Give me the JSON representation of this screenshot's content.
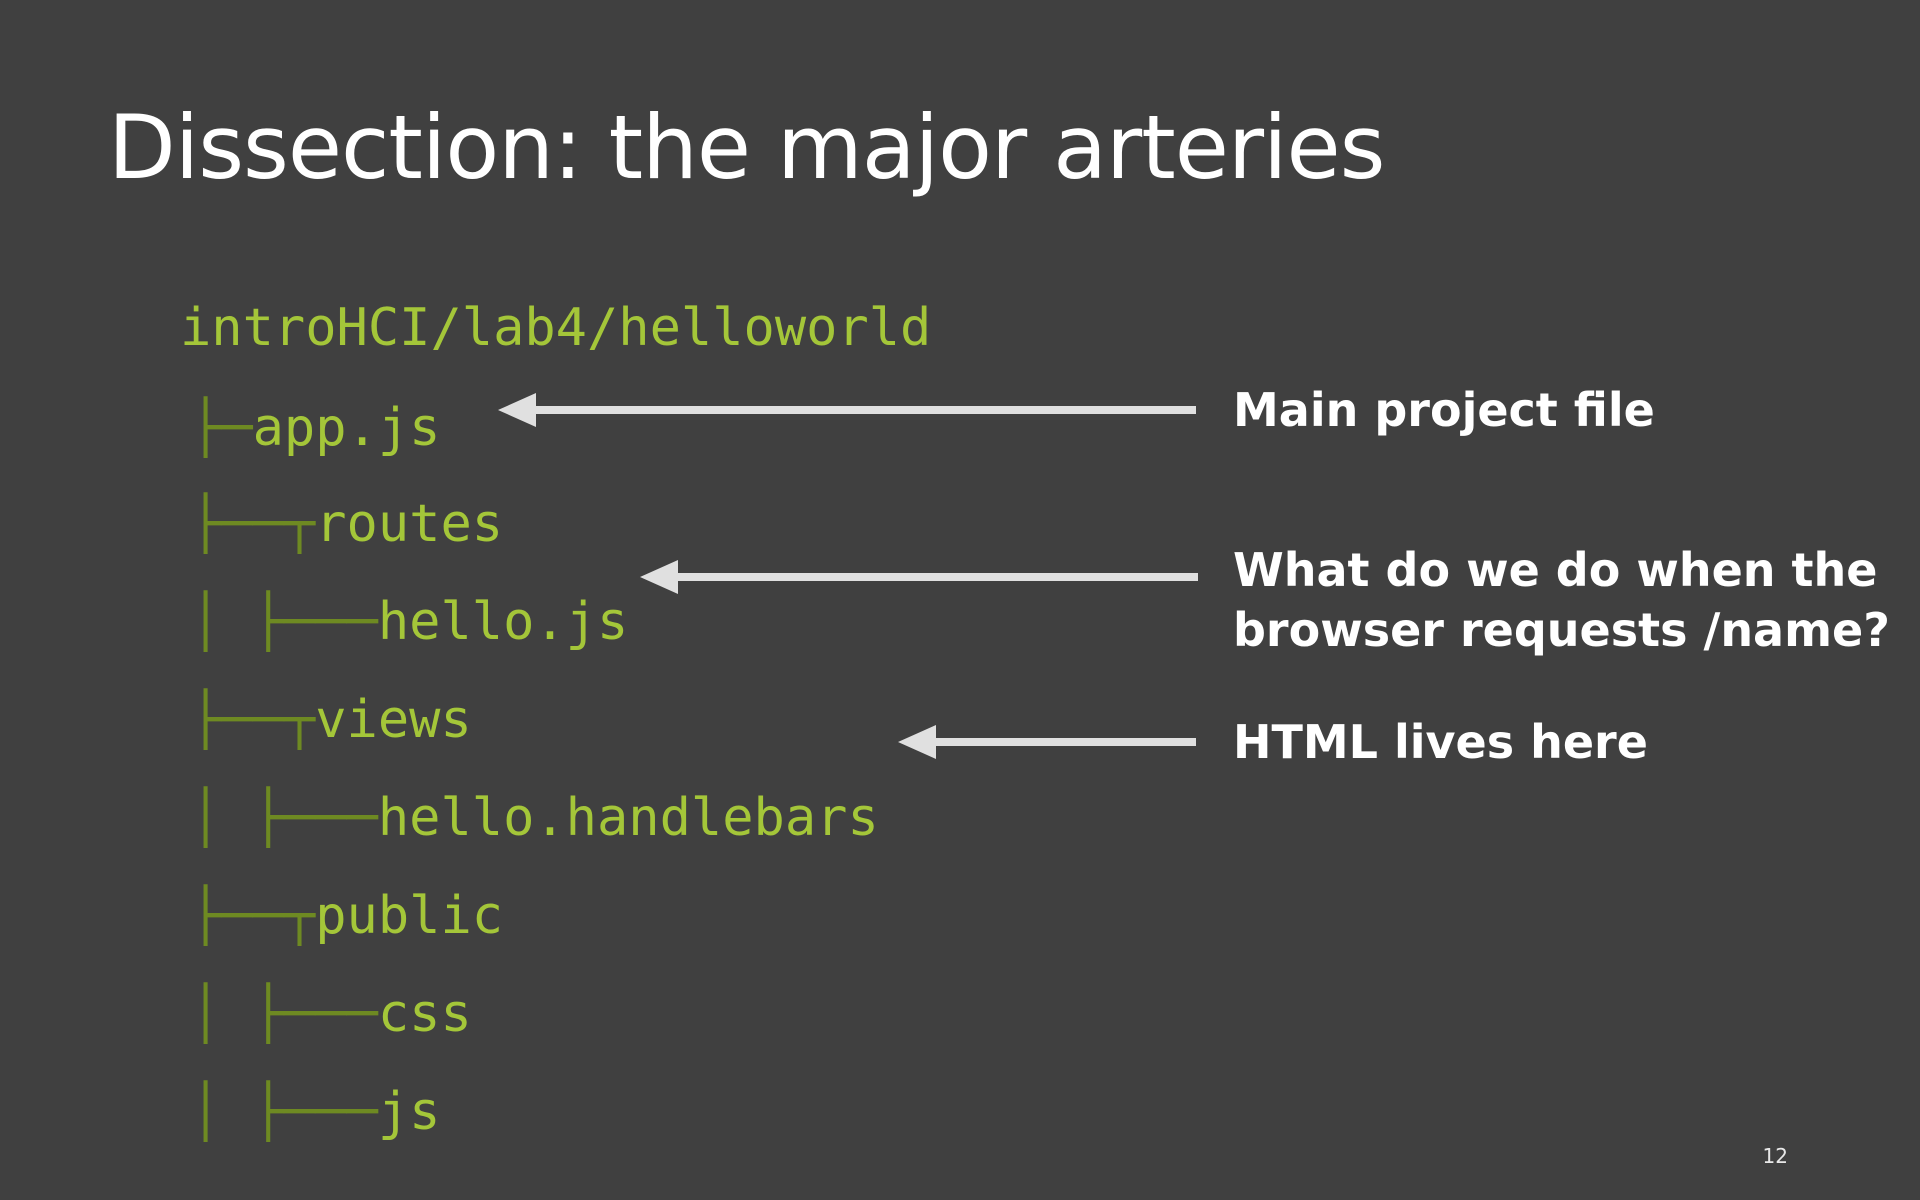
{
  "slide": {
    "title": "Dissection: the major arteries",
    "page_number": "12"
  },
  "tree": {
    "root": "introHCI/lab4/helloworld",
    "rows": [
      {
        "branch": "├─",
        "name": "app.js"
      },
      {
        "branch": "├──┬",
        "name": "routes"
      },
      {
        "branch": "│  ├───",
        "name": "hello.js"
      },
      {
        "branch": "├──┬",
        "name": "views"
      },
      {
        "branch": "│  ├───",
        "name": "hello.handlebars"
      },
      {
        "branch": "├──┬",
        "name": "public"
      },
      {
        "branch": "│  ├───",
        "name": "css"
      },
      {
        "branch": "│  ├───",
        "name": "js"
      }
    ]
  },
  "annotations": [
    {
      "lines": [
        "Main project file"
      ],
      "target": "app.js"
    },
    {
      "lines": [
        "What do we do when the",
        "browser requests /name?"
      ],
      "target": "hello.js"
    },
    {
      "lines": [
        "HTML lives here"
      ],
      "target": "hello.handlebars"
    }
  ],
  "colors": {
    "background": "#404040",
    "tree_text": "#a4c639",
    "tree_branch": "#6e8a22",
    "arrow": "#e0e0e0",
    "text": "#ffffff"
  }
}
